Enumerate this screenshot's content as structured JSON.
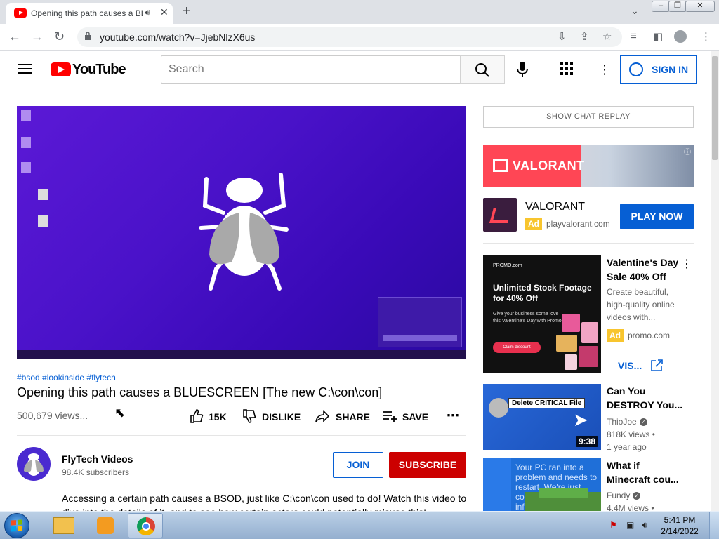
{
  "browser": {
    "tab_title": "Opening this path causes a BLUESCREEN [The new C:\\con\\con]",
    "url": "youtube.com/watch?v=JjebNlzX6us"
  },
  "header": {
    "logo_text": "YouTube",
    "search_placeholder": "Search",
    "signin_label": "SIGN IN"
  },
  "video": {
    "tags": "#bsod #lookinside #flytech",
    "title": "Opening this path causes a BLUESCREEN [The new C:\\con\\con]",
    "views": "500,679 views...",
    "actions": {
      "like_count": "15K",
      "dislike": "DISLIKE",
      "share": "SHARE",
      "save": "SAVE"
    },
    "channel": {
      "name": "FlyTech Videos",
      "subscribers": "98.4K subscribers",
      "join": "JOIN",
      "subscribe": "SUBSCRIBE"
    },
    "description": "Accessing a certain path causes a BSOD, just like C:\\con\\con used to do! Watch this video to dive into the details of it, and to see how certain actors could potentially misuse this!"
  },
  "sidebar": {
    "chat_replay": "SHOW CHAT REPLAY",
    "ad1": {
      "banner_text": "VALORANT",
      "title": "VALORANT",
      "badge": "Ad",
      "domain": "playvalorant.com",
      "cta": "PLAY NOW"
    },
    "ad2": {
      "image_brand": "PROMO.com",
      "image_headline": "Unlimited Stock Footage for 40% Off",
      "image_sub": "Give your business some love this Valentine's Day with Promo",
      "image_cta": "Claim discount",
      "title": "Valentine's Day Sale 40% Off",
      "desc": "Create beautiful, high-quality online videos with...",
      "badge": "Ad",
      "domain": "promo.com",
      "cta": "VIS..."
    },
    "related": [
      {
        "title": "Can You DESTROY You...",
        "channel": "ThioJoe",
        "views": "818K views •",
        "age": "1 year ago",
        "duration": "9:38",
        "thumb_text": "Delete CRITICAL File"
      },
      {
        "title": "What if Minecraft cou...",
        "channel": "Fundy",
        "views": "4.4M views •",
        "thumb_text": "Your PC ran into a problem and needs to restart. We're just collecting some error info, and then we'll restart for you."
      }
    ]
  },
  "taskbar": {
    "time": "5:41 PM",
    "date": "2/14/2022"
  },
  "colors": {
    "youtube_red": "#ff0000",
    "link_blue": "#065fd4",
    "subscribe_red": "#cc0000",
    "ad_badge": "#f8c52e"
  }
}
